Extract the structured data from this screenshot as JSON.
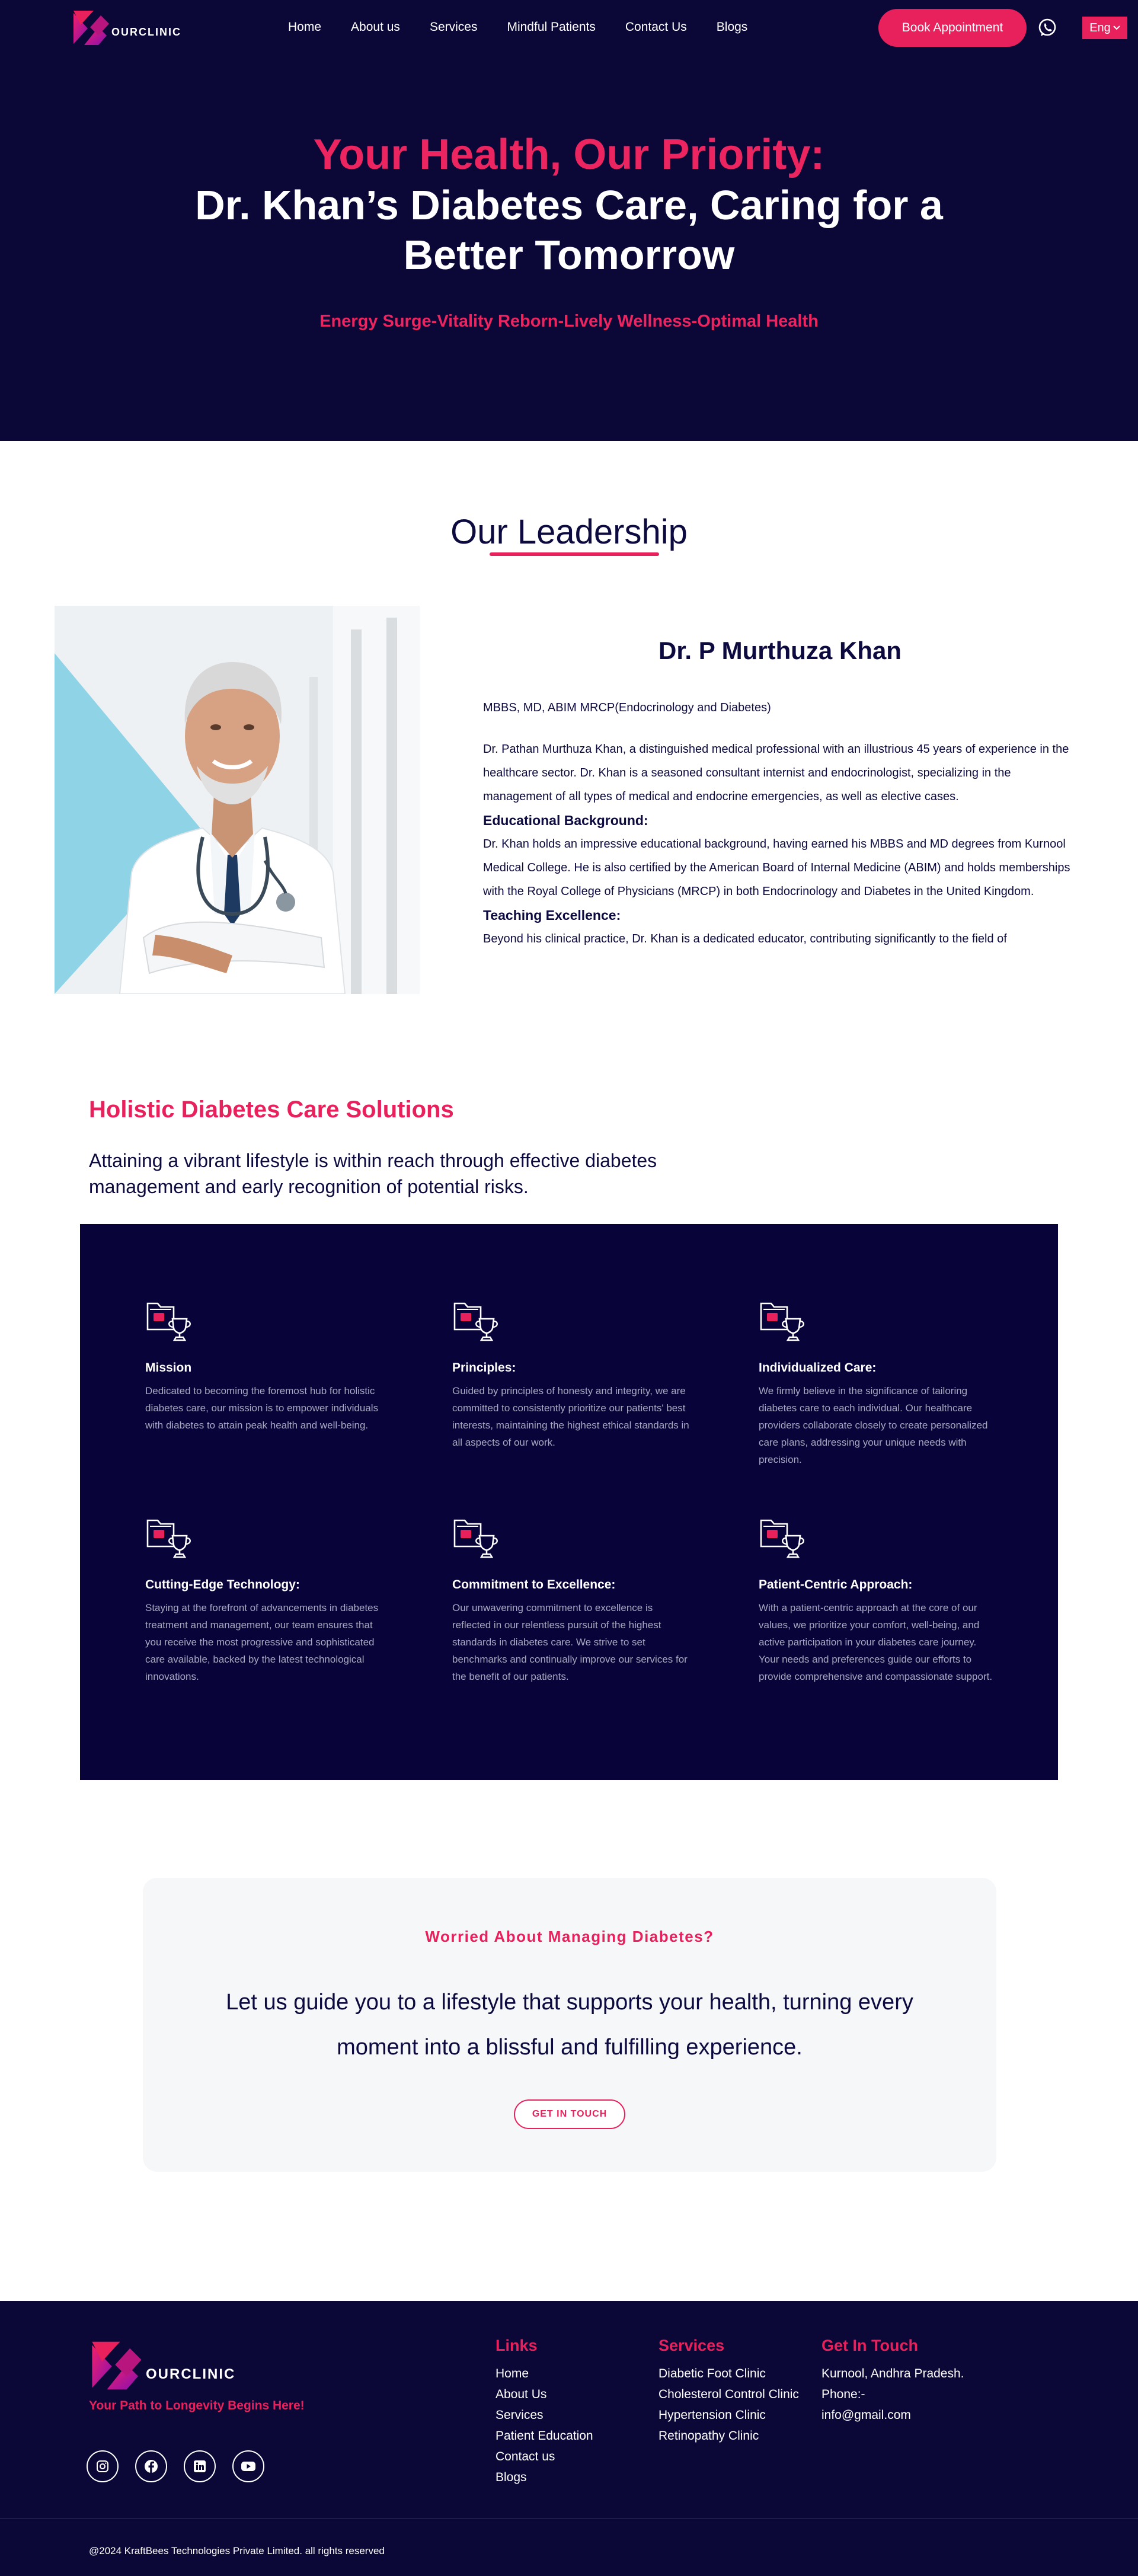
{
  "brand": {
    "logo_text": "OURCLINIC",
    "accent_color": "#e8205c",
    "navy_color": "#0b0838"
  },
  "nav": {
    "links": [
      "Home",
      "About us",
      "Services",
      "Mindful Patients",
      "Contact Us",
      "Blogs"
    ],
    "book_button": "Book Appointment",
    "whatsapp_icon": "whatsapp-icon",
    "language": "Eng"
  },
  "hero": {
    "line1": "Your Health, Our Priority:",
    "line2": "Dr. Khan’s Diabetes Care, Caring for a",
    "line3": "Better Tomorrow",
    "subtitle": "Energy Surge-Vitality Reborn-Lively Wellness-Optimal Health"
  },
  "leadership": {
    "title": "Our Leadership",
    "name": "Dr. P Murthuza Khan",
    "credentials": "MBBS, MD, ABIM MRCP(Endocrinology and Diabetes)",
    "intro": "Dr. Pathan Murthuza Khan, a distinguished medical professional with an illustrious 45 years of experience in the healthcare sector. Dr. Khan is a seasoned consultant internist and endocrinologist, specializing in the management of all types of medical and endocrine emergencies, as well as elective cases.",
    "edu_heading": "Educational Background:",
    "edu_text": "Dr. Khan holds an impressive educational background, having earned his MBBS and MD degrees from Kurnool Medical College. He is also certified by the American Board of Internal Medicine (ABIM) and holds memberships with the Royal College of Physicians (MRCP) in both Endocrinology and Diabetes in the United Kingdom.",
    "teach_heading": "Teaching Excellence:",
    "teach_text": "Beyond his clinical practice, Dr. Khan is a dedicated educator, contributing significantly to the field of"
  },
  "solutions": {
    "title": "Holistic Diabetes Care Solutions",
    "description": "Attaining a vibrant lifestyle is within reach through effective diabetes management and early recognition of potential risks.",
    "features": [
      {
        "title": "Mission",
        "icon": "folder-trophy-icon",
        "text": "Dedicated to becoming the foremost hub for holistic diabetes care, our mission is to empower individuals with diabetes to attain peak health and well-being."
      },
      {
        "title": "Principles:",
        "icon": "folder-trophy-icon",
        "text": "Guided by principles of honesty and integrity, we are committed to consistently prioritize our patients' best interests, maintaining the highest ethical standards in all aspects of our work."
      },
      {
        "title": "Individualized Care:",
        "icon": "folder-trophy-icon",
        "text": "We firmly believe in the significance of tailoring diabetes care to each individual. Our healthcare providers collaborate closely to create personalized care plans, addressing your unique needs with precision."
      },
      {
        "title": "Cutting-Edge Technology:",
        "icon": "folder-trophy-icon",
        "text": "Staying at the forefront of advancements in diabetes treatment and management, our team ensures that you receive the most progressive and sophisticated care available, backed by the latest technological innovations."
      },
      {
        "title": "Commitment to Excellence:",
        "icon": "folder-trophy-icon",
        "text": "Our unwavering commitment to excellence is reflected in our relentless pursuit of the highest standards in diabetes care. We strive to set benchmarks and continually improve our services for the benefit of our patients."
      },
      {
        "title": "Patient-Centric Approach:",
        "icon": "folder-trophy-icon",
        "text": "With a patient-centric approach at the core of our values, we prioritize your comfort, well-being, and active participation in your diabetes care journey. Your needs and preferences guide our efforts to provide comprehensive and compassionate support."
      }
    ]
  },
  "cta": {
    "kicker": "Worried About Managing Diabetes?",
    "text": "Let us guide you to a lifestyle that supports your health, turning every moment into a blissful and fulfilling experience.",
    "button": "GET IN TOUCH"
  },
  "footer": {
    "tagline": "Your Path to Longevity Begins Here!",
    "socials": [
      "instagram-icon",
      "facebook-icon",
      "linkedin-icon",
      "youtube-icon"
    ],
    "links_title": "Links",
    "links": [
      "Home",
      "About Us",
      "Services",
      "Patient Education",
      "Contact us",
      "Blogs"
    ],
    "services_title": "Services",
    "services": [
      "Diabetic Foot Clinic",
      "Cholesterol Control Clinic",
      "Hypertension Clinic",
      "Retinopathy Clinic"
    ],
    "contact_title": "Get In Touch",
    "contact": [
      "Kurnool, Andhra Pradesh.",
      "Phone:-",
      "info@gmail.com"
    ],
    "copyright": "@2024 KraftBees Technologies Private Limited. all rights reserved"
  }
}
